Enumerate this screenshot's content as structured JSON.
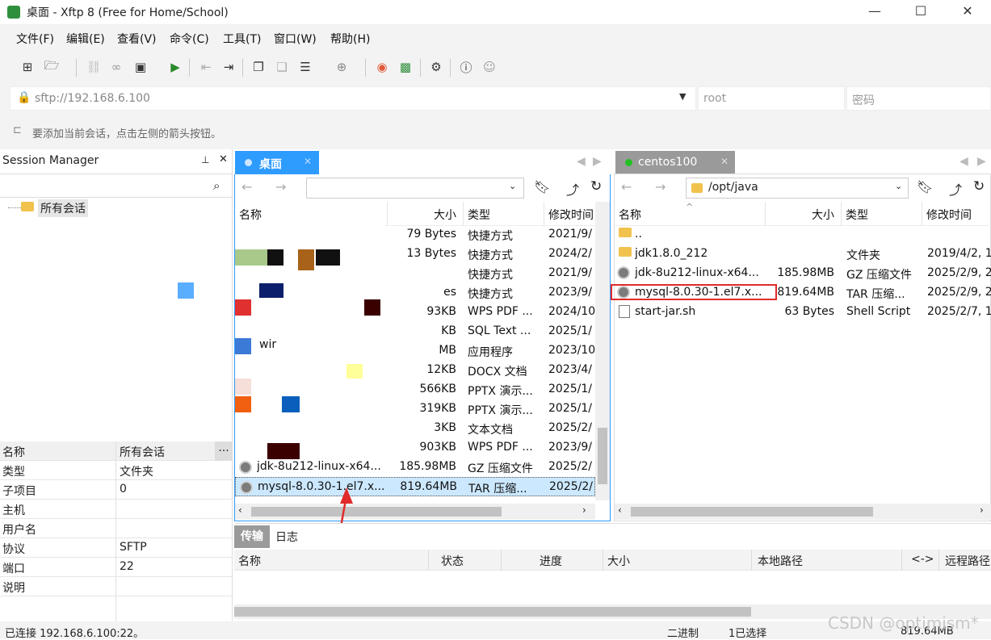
{
  "window": {
    "title": "桌面 - Xftp 8 (Free for Home/School)",
    "minimize": "—",
    "maximize": "☐",
    "close": "✕"
  },
  "menu": [
    "文件(F)",
    "编辑(E)",
    "查看(V)",
    "命令(C)",
    "工具(T)",
    "窗口(W)",
    "帮助(H)"
  ],
  "address": {
    "url": "sftp://192.168.6.100",
    "user_placeholder": "root",
    "password_placeholder": "密码"
  },
  "hint": "要添加当前会话，点击左侧的箭头按钮。",
  "session_manager": {
    "title": "Session Manager",
    "pin": "📌",
    "close": "✕",
    "tree_root": "所有会话",
    "properties": [
      {
        "k": "名称",
        "v": "所有会话"
      },
      {
        "k": "类型",
        "v": "文件夹"
      },
      {
        "k": "子项目",
        "v": "0"
      },
      {
        "k": "主机",
        "v": ""
      },
      {
        "k": "用户名",
        "v": ""
      },
      {
        "k": "协议",
        "v": "SFTP"
      },
      {
        "k": "端口",
        "v": "22"
      },
      {
        "k": "说明",
        "v": ""
      }
    ],
    "more": "..."
  },
  "local": {
    "tab": "桌面",
    "columns": [
      "名称",
      "大小",
      "类型",
      "修改时间"
    ],
    "rows": [
      {
        "name": "",
        "size": "79 Bytes",
        "type": "快捷方式",
        "date": "2021/9/"
      },
      {
        "name": "",
        "size": "13 Bytes",
        "type": "快捷方式",
        "date": "2024/2/"
      },
      {
        "name": "",
        "size": "",
        "type": "快捷方式",
        "date": "2021/9/"
      },
      {
        "name": "",
        "size": "es",
        "type": "快捷方式",
        "date": "2023/9/"
      },
      {
        "name": "",
        "size": "93KB",
        "type": "WPS PDF ...",
        "date": "2024/10"
      },
      {
        "name": "",
        "size": "KB",
        "type": "SQL Text ...",
        "date": "2025/1/"
      },
      {
        "name": "wir",
        "size": "MB",
        "type": "应用程序",
        "date": "2023/10"
      },
      {
        "name": "",
        "size": "12KB",
        "type": "DOCX 文档",
        "date": "2023/4/"
      },
      {
        "name": "",
        "size": "566KB",
        "type": "PPTX 演示...",
        "date": "2025/1/"
      },
      {
        "name": "",
        "size": "319KB",
        "type": "PPTX 演示...",
        "date": "2025/1/"
      },
      {
        "name": "",
        "size": "3KB",
        "type": "文本文档",
        "date": "2025/2/"
      },
      {
        "name": "",
        "size": "903KB",
        "type": "WPS PDF ...",
        "date": "2023/9/"
      },
      {
        "name": "jdk-8u212-linux-x64...",
        "size": "185.98MB",
        "type": "GZ 压缩文件",
        "date": "2025/2/"
      },
      {
        "name": "mysql-8.0.30-1.el7.x...",
        "size": "819.64MB",
        "type": "TAR 压缩...",
        "date": "2025/2/"
      }
    ]
  },
  "remote": {
    "tab": "centos100",
    "path": "/opt/java",
    "columns": [
      "名称",
      "大小",
      "类型",
      "修改时间"
    ],
    "rows": [
      {
        "name": "..",
        "size": "",
        "type": "",
        "date": "",
        "icon": "folder"
      },
      {
        "name": "jdk1.8.0_212",
        "size": "",
        "type": "文件夹",
        "date": "2019/4/2, 1",
        "icon": "folder"
      },
      {
        "name": "jdk-8u212-linux-x64...",
        "size": "185.98MB",
        "type": "GZ 压缩文件",
        "date": "2025/2/9, 2",
        "icon": "archive"
      },
      {
        "name": "mysql-8.0.30-1.el7.x...",
        "size": "819.64MB",
        "type": "TAR 压缩...",
        "date": "2025/2/9, 2",
        "icon": "archive"
      },
      {
        "name": "start-jar.sh",
        "size": "63 Bytes",
        "type": "Shell Script",
        "date": "2025/2/7, 1",
        "icon": "script"
      }
    ]
  },
  "transfer": {
    "tabs": [
      "传输",
      "日志"
    ],
    "columns": [
      "名称",
      "状态",
      "进度",
      "大小",
      "本地路径",
      "<->",
      "远程路径"
    ]
  },
  "status": {
    "left": "已连接 192.168.6.100:22。",
    "mode": "二进制",
    "selection": "1已选择",
    "size": "819.64MB"
  },
  "watermark": "CSDN @optimism*",
  "colors": {
    "accent": "#2e9bff",
    "tab_remote": "#9a9a9a",
    "highlight": "#e02b2b",
    "online": "#22c022"
  }
}
